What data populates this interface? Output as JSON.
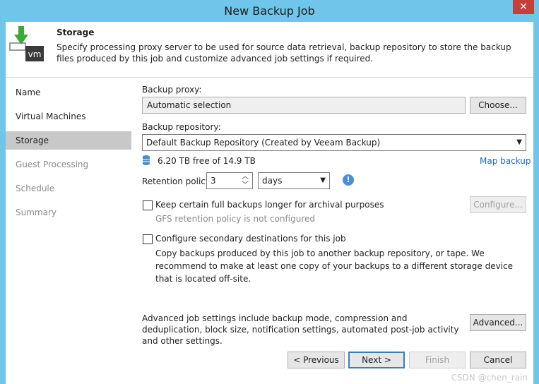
{
  "window": {
    "title": "New Backup Job",
    "close_glyph": "✕"
  },
  "header": {
    "title": "Storage",
    "description": "Specify processing proxy server to be used for source data retrieval, backup repository to store the backup files produced by this job and customize advanced job settings if required.",
    "icon": "vm-download-icon",
    "icon_text": "vm"
  },
  "nav": {
    "items": [
      {
        "label": "Name",
        "state": "normal"
      },
      {
        "label": "Virtual Machines",
        "state": "normal"
      },
      {
        "label": "Storage",
        "state": "selected"
      },
      {
        "label": "Guest Processing",
        "state": "disabled"
      },
      {
        "label": "Schedule",
        "state": "disabled"
      },
      {
        "label": "Summary",
        "state": "disabled"
      }
    ]
  },
  "proxy": {
    "label": "Backup proxy:",
    "value": "Automatic selection",
    "choose_button": "Choose..."
  },
  "repository": {
    "label": "Backup repository:",
    "selected": "Default Backup Repository (Created by Veeam Backup)",
    "free_space": "6.20 TB free of 14.9 TB",
    "map_link": "Map backup"
  },
  "retention": {
    "label": "Retention policy:",
    "value": "3",
    "unit": "days",
    "info_glyph": "!"
  },
  "archival": {
    "label": "Keep certain full backups longer for archival purposes",
    "checked": false,
    "status": "GFS retention policy is not configured",
    "configure_button": "Configure..."
  },
  "secondary": {
    "label": "Configure secondary destinations for this job",
    "checked": false,
    "description": "Copy backups produced by this job to another backup repository, or tape. We recommend to make at least one copy of your backups to a different storage device that is located off-site."
  },
  "advanced": {
    "text": "Advanced job settings include backup mode, compression and deduplication, block size, notification settings, automated post-job activity and other settings.",
    "button": "Advanced..."
  },
  "footer": {
    "previous": "< Previous",
    "next": "Next >",
    "finish": "Finish",
    "cancel": "Cancel"
  },
  "watermark": "CSDN @chen_rain",
  "colors": {
    "titlebar": "#6fc6ea",
    "close": "#c63f3a",
    "link": "#1a6bb5",
    "icon_green": "#3aa935"
  }
}
